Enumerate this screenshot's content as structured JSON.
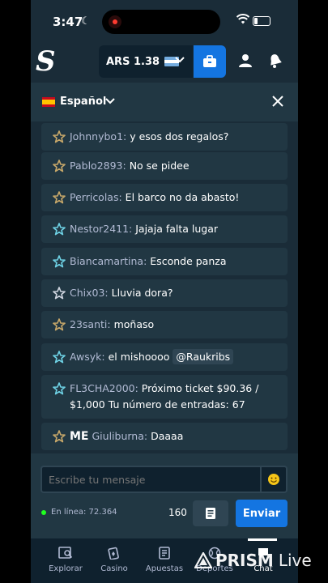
{
  "status_bar": {
    "time": "3:47"
  },
  "header": {
    "currency_amount": "ARS 1.38",
    "colors": {
      "accent": "#1475e1",
      "panel": "#213743",
      "background": "#1a2c38"
    }
  },
  "chat": {
    "language": "Español",
    "messages": [
      {
        "user": "Johnnybo1:",
        "text": " y esos dos regalos?",
        "star_color": "#c9a96a"
      },
      {
        "user": "Pablo2893:",
        "text": " No se pidee",
        "star_color": "#c9a96a"
      },
      {
        "user": "Perricolas:",
        "text": " El barco no da abasto!",
        "star_color": "#c9a96a"
      },
      {
        "user": "Nestor2411:",
        "text": " Jajaja falta lugar",
        "star_color": "#6fd3e6"
      },
      {
        "user": "Biancamartina:",
        "text": " Esconde panza",
        "star_color": "#6fd3e6"
      },
      {
        "user": "Chix03:",
        "text": " Lluvia dora?",
        "star_color": "#d0d6e0"
      },
      {
        "user": "23santi:",
        "text": " moñaso",
        "star_color": "#c9a96a"
      },
      {
        "user": "Awsyk:",
        "text": " el mishoooo ",
        "mention": "@Raukribs",
        "star_color": "#6fd3e6"
      },
      {
        "user": "FL3CHA2000:",
        "text": " Próximo ticket $90.36 / $1,000 Tu número de entradas: 67",
        "star_color": "#6fd3e6"
      },
      {
        "user": "Giuliburna:",
        "text": " Daaaa",
        "badge": "ME",
        "star_color": "#c9a96a"
      }
    ],
    "input_placeholder": "Escribe tu mensaje",
    "online_text": "En línea: 72.364",
    "char_count": "160",
    "send_label": "Enviar"
  },
  "bottom_nav": [
    {
      "label": "Explorar",
      "icon": "search-icon"
    },
    {
      "label": "Casino",
      "icon": "cards-icon"
    },
    {
      "label": "Apuestas",
      "icon": "ticket-icon"
    },
    {
      "label": "Deportes",
      "icon": "ball-icon"
    },
    {
      "label": "Chat",
      "icon": "chat-icon"
    }
  ],
  "watermark": {
    "brand": "PRISM",
    "suffix": "Live"
  }
}
